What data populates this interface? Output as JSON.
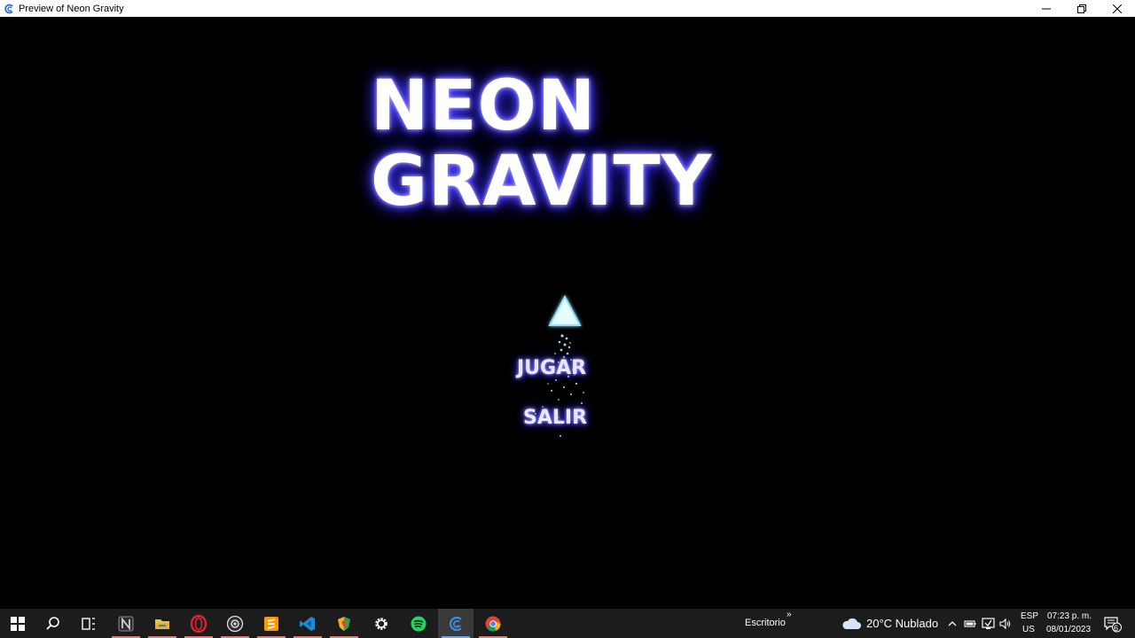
{
  "window": {
    "title": "Preview of Neon Gravity"
  },
  "game": {
    "title_line1": "NEON",
    "title_line2": "GRAVITY",
    "menu": {
      "play_label": "JUGAR",
      "exit_label": "SALIR"
    }
  },
  "taskbar": {
    "apps": [
      {
        "icon": "windows-start-icon"
      },
      {
        "icon": "search-icon"
      },
      {
        "icon": "task-view-icon"
      },
      {
        "icon": "notion-icon"
      },
      {
        "icon": "file-explorer-icon"
      },
      {
        "icon": "opera-icon"
      },
      {
        "icon": "obs-icon"
      },
      {
        "icon": "sublime-text-icon"
      },
      {
        "icon": "vscode-icon"
      },
      {
        "icon": "shield-app-icon"
      },
      {
        "icon": "settings-icon"
      },
      {
        "icon": "spotify-icon"
      },
      {
        "icon": "gdevelop-icon"
      },
      {
        "icon": "chrome-icon"
      }
    ],
    "desktop_label": "Escritorio",
    "desktop_chevron": "»",
    "weather": "20°C  Nublado",
    "language_line1": "ESP",
    "language_line2": "US",
    "time": "07:23 p. m.",
    "date": "08/01/2023",
    "notification_count": "6"
  },
  "colors": {
    "neon_glow": "#3b30ff",
    "ship": "#bff0ff",
    "particles": "#7fd8ff",
    "taskbar": "#1c1c1c"
  }
}
